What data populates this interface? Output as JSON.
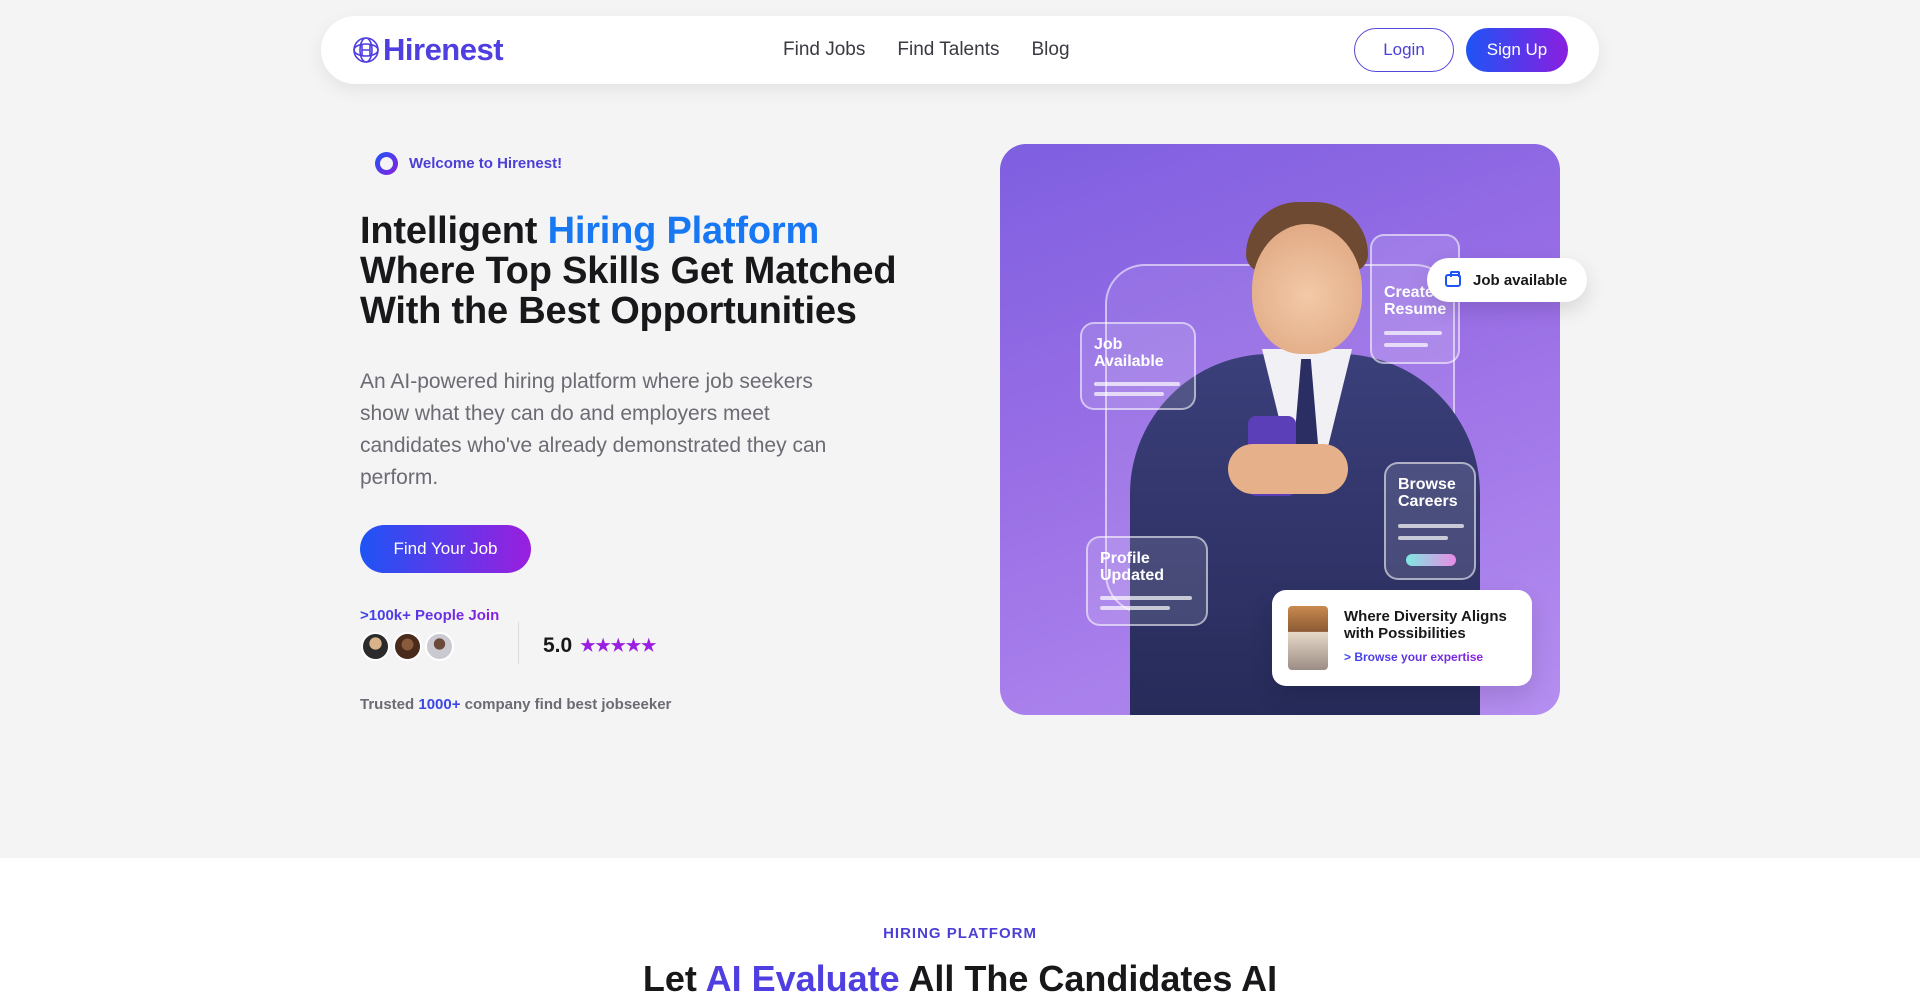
{
  "brand": {
    "name": "Hirenest",
    "accent": "#4f3ee0",
    "gradient": [
      "#1e54f5",
      "#8a1fe0"
    ]
  },
  "nav": {
    "links": [
      "Find Jobs",
      "Find Talents",
      "Blog"
    ],
    "login": "Login",
    "signup": "Sign Up"
  },
  "hero": {
    "welcome": "Welcome to Hirenest!",
    "headline_pre": "Intelligent ",
    "headline_accent": "Hiring Platform",
    "headline_line2": "Where Top Skills Get Matched",
    "headline_line3": "With the Best Opportunities",
    "description": "An AI-powered hiring platform where job seekers show what they can do and employers meet candidates who've already demonstrated they can perform.",
    "cta": "Find Your Job",
    "join_label": ">100k+ People Join",
    "rating": "5.0",
    "stars": "★★★★★",
    "trusted_pre": "Trusted ",
    "trusted_count": "1000+",
    "trusted_post": " company find best jobseeker"
  },
  "hero_image": {
    "cards": {
      "job_available": "Job Available",
      "create_resume": "Create Resume",
      "browse_careers": "Browse Careers",
      "profile_updated": "Profile Updated"
    },
    "job_pill": "Job available",
    "diversity_title": "Where Diversity Aligns with Possibilities",
    "diversity_link": "> Browse your expertise"
  },
  "section2": {
    "label": "HIRING PLATFORM",
    "title_pre": "Let ",
    "title_accent": "AI Evaluate",
    "title_post": " All The Candidates AI"
  }
}
